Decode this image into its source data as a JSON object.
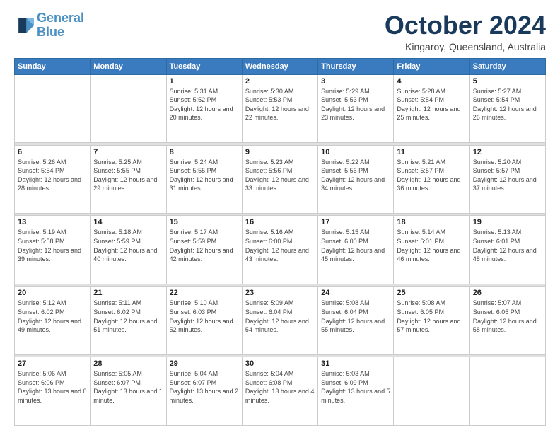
{
  "header": {
    "logo_line1": "General",
    "logo_line2": "Blue",
    "main_title": "October 2024",
    "subtitle": "Kingaroy, Queensland, Australia"
  },
  "calendar": {
    "days_of_week": [
      "Sunday",
      "Monday",
      "Tuesday",
      "Wednesday",
      "Thursday",
      "Friday",
      "Saturday"
    ],
    "weeks": [
      [
        {
          "day": "",
          "info": ""
        },
        {
          "day": "",
          "info": ""
        },
        {
          "day": "1",
          "sunrise": "5:31 AM",
          "sunset": "5:52 PM",
          "daylight": "12 hours and 20 minutes."
        },
        {
          "day": "2",
          "sunrise": "5:30 AM",
          "sunset": "5:53 PM",
          "daylight": "12 hours and 22 minutes."
        },
        {
          "day": "3",
          "sunrise": "5:29 AM",
          "sunset": "5:53 PM",
          "daylight": "12 hours and 23 minutes."
        },
        {
          "day": "4",
          "sunrise": "5:28 AM",
          "sunset": "5:54 PM",
          "daylight": "12 hours and 25 minutes."
        },
        {
          "day": "5",
          "sunrise": "5:27 AM",
          "sunset": "5:54 PM",
          "daylight": "12 hours and 26 minutes."
        }
      ],
      [
        {
          "day": "6",
          "sunrise": "5:26 AM",
          "sunset": "5:54 PM",
          "daylight": "12 hours and 28 minutes."
        },
        {
          "day": "7",
          "sunrise": "5:25 AM",
          "sunset": "5:55 PM",
          "daylight": "12 hours and 29 minutes."
        },
        {
          "day": "8",
          "sunrise": "5:24 AM",
          "sunset": "5:55 PM",
          "daylight": "12 hours and 31 minutes."
        },
        {
          "day": "9",
          "sunrise": "5:23 AM",
          "sunset": "5:56 PM",
          "daylight": "12 hours and 33 minutes."
        },
        {
          "day": "10",
          "sunrise": "5:22 AM",
          "sunset": "5:56 PM",
          "daylight": "12 hours and 34 minutes."
        },
        {
          "day": "11",
          "sunrise": "5:21 AM",
          "sunset": "5:57 PM",
          "daylight": "12 hours and 36 minutes."
        },
        {
          "day": "12",
          "sunrise": "5:20 AM",
          "sunset": "5:57 PM",
          "daylight": "12 hours and 37 minutes."
        }
      ],
      [
        {
          "day": "13",
          "sunrise": "5:19 AM",
          "sunset": "5:58 PM",
          "daylight": "12 hours and 39 minutes."
        },
        {
          "day": "14",
          "sunrise": "5:18 AM",
          "sunset": "5:59 PM",
          "daylight": "12 hours and 40 minutes."
        },
        {
          "day": "15",
          "sunrise": "5:17 AM",
          "sunset": "5:59 PM",
          "daylight": "12 hours and 42 minutes."
        },
        {
          "day": "16",
          "sunrise": "5:16 AM",
          "sunset": "6:00 PM",
          "daylight": "12 hours and 43 minutes."
        },
        {
          "day": "17",
          "sunrise": "5:15 AM",
          "sunset": "6:00 PM",
          "daylight": "12 hours and 45 minutes."
        },
        {
          "day": "18",
          "sunrise": "5:14 AM",
          "sunset": "6:01 PM",
          "daylight": "12 hours and 46 minutes."
        },
        {
          "day": "19",
          "sunrise": "5:13 AM",
          "sunset": "6:01 PM",
          "daylight": "12 hours and 48 minutes."
        }
      ],
      [
        {
          "day": "20",
          "sunrise": "5:12 AM",
          "sunset": "6:02 PM",
          "daylight": "12 hours and 49 minutes."
        },
        {
          "day": "21",
          "sunrise": "5:11 AM",
          "sunset": "6:02 PM",
          "daylight": "12 hours and 51 minutes."
        },
        {
          "day": "22",
          "sunrise": "5:10 AM",
          "sunset": "6:03 PM",
          "daylight": "12 hours and 52 minutes."
        },
        {
          "day": "23",
          "sunrise": "5:09 AM",
          "sunset": "6:04 PM",
          "daylight": "12 hours and 54 minutes."
        },
        {
          "day": "24",
          "sunrise": "5:08 AM",
          "sunset": "6:04 PM",
          "daylight": "12 hours and 55 minutes."
        },
        {
          "day": "25",
          "sunrise": "5:08 AM",
          "sunset": "6:05 PM",
          "daylight": "12 hours and 57 minutes."
        },
        {
          "day": "26",
          "sunrise": "5:07 AM",
          "sunset": "6:05 PM",
          "daylight": "12 hours and 58 minutes."
        }
      ],
      [
        {
          "day": "27",
          "sunrise": "5:06 AM",
          "sunset": "6:06 PM",
          "daylight": "13 hours and 0 minutes."
        },
        {
          "day": "28",
          "sunrise": "5:05 AM",
          "sunset": "6:07 PM",
          "daylight": "13 hours and 1 minute."
        },
        {
          "day": "29",
          "sunrise": "5:04 AM",
          "sunset": "6:07 PM",
          "daylight": "13 hours and 2 minutes."
        },
        {
          "day": "30",
          "sunrise": "5:04 AM",
          "sunset": "6:08 PM",
          "daylight": "13 hours and 4 minutes."
        },
        {
          "day": "31",
          "sunrise": "5:03 AM",
          "sunset": "6:09 PM",
          "daylight": "13 hours and 5 minutes."
        },
        {
          "day": "",
          "info": ""
        },
        {
          "day": "",
          "info": ""
        }
      ]
    ]
  }
}
